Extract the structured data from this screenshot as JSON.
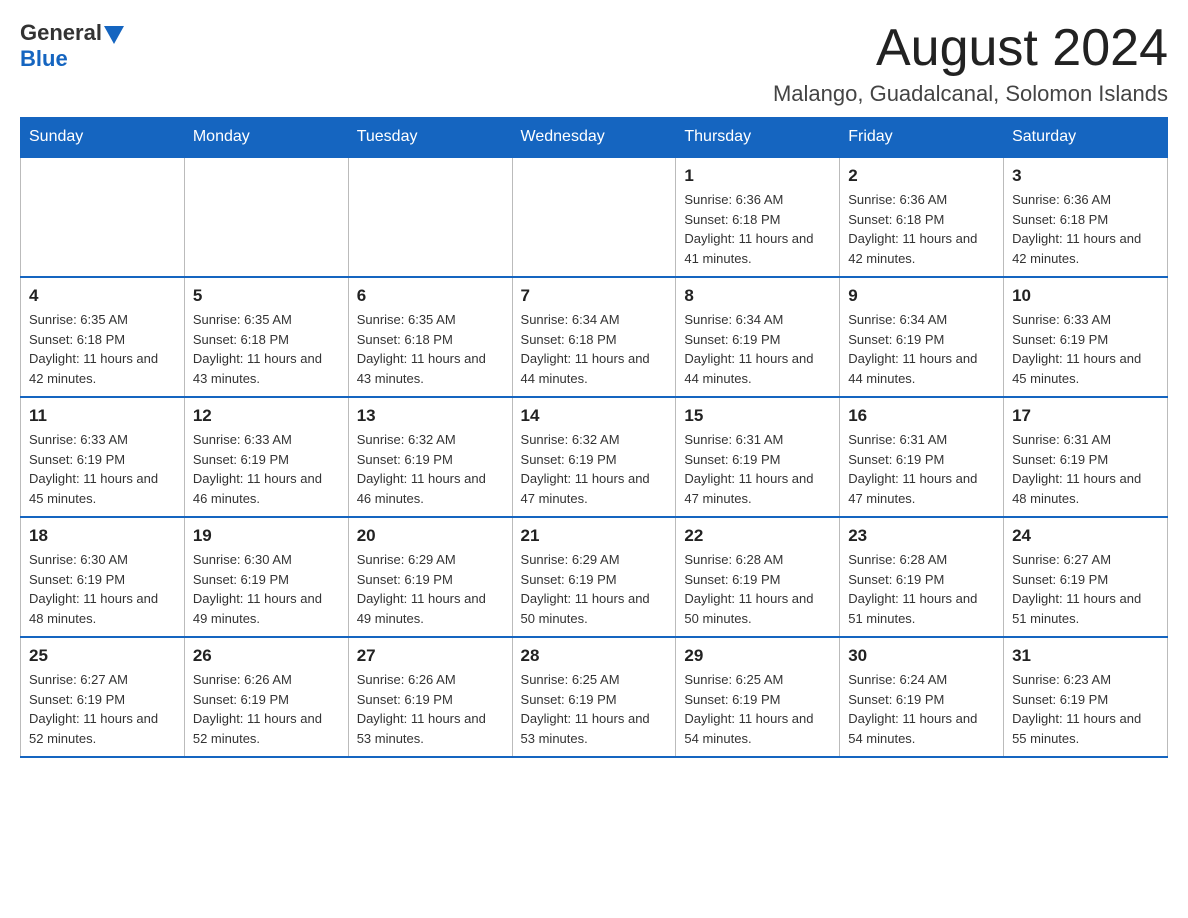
{
  "header": {
    "logo_general": "General",
    "logo_blue": "Blue",
    "month_year": "August 2024",
    "location": "Malango, Guadalcanal, Solomon Islands"
  },
  "days_of_week": [
    "Sunday",
    "Monday",
    "Tuesday",
    "Wednesday",
    "Thursday",
    "Friday",
    "Saturday"
  ],
  "weeks": [
    [
      {
        "day": "",
        "info": ""
      },
      {
        "day": "",
        "info": ""
      },
      {
        "day": "",
        "info": ""
      },
      {
        "day": "",
        "info": ""
      },
      {
        "day": "1",
        "info": "Sunrise: 6:36 AM\nSunset: 6:18 PM\nDaylight: 11 hours and 41 minutes."
      },
      {
        "day": "2",
        "info": "Sunrise: 6:36 AM\nSunset: 6:18 PM\nDaylight: 11 hours and 42 minutes."
      },
      {
        "day": "3",
        "info": "Sunrise: 6:36 AM\nSunset: 6:18 PM\nDaylight: 11 hours and 42 minutes."
      }
    ],
    [
      {
        "day": "4",
        "info": "Sunrise: 6:35 AM\nSunset: 6:18 PM\nDaylight: 11 hours and 42 minutes."
      },
      {
        "day": "5",
        "info": "Sunrise: 6:35 AM\nSunset: 6:18 PM\nDaylight: 11 hours and 43 minutes."
      },
      {
        "day": "6",
        "info": "Sunrise: 6:35 AM\nSunset: 6:18 PM\nDaylight: 11 hours and 43 minutes."
      },
      {
        "day": "7",
        "info": "Sunrise: 6:34 AM\nSunset: 6:18 PM\nDaylight: 11 hours and 44 minutes."
      },
      {
        "day": "8",
        "info": "Sunrise: 6:34 AM\nSunset: 6:19 PM\nDaylight: 11 hours and 44 minutes."
      },
      {
        "day": "9",
        "info": "Sunrise: 6:34 AM\nSunset: 6:19 PM\nDaylight: 11 hours and 44 minutes."
      },
      {
        "day": "10",
        "info": "Sunrise: 6:33 AM\nSunset: 6:19 PM\nDaylight: 11 hours and 45 minutes."
      }
    ],
    [
      {
        "day": "11",
        "info": "Sunrise: 6:33 AM\nSunset: 6:19 PM\nDaylight: 11 hours and 45 minutes."
      },
      {
        "day": "12",
        "info": "Sunrise: 6:33 AM\nSunset: 6:19 PM\nDaylight: 11 hours and 46 minutes."
      },
      {
        "day": "13",
        "info": "Sunrise: 6:32 AM\nSunset: 6:19 PM\nDaylight: 11 hours and 46 minutes."
      },
      {
        "day": "14",
        "info": "Sunrise: 6:32 AM\nSunset: 6:19 PM\nDaylight: 11 hours and 47 minutes."
      },
      {
        "day": "15",
        "info": "Sunrise: 6:31 AM\nSunset: 6:19 PM\nDaylight: 11 hours and 47 minutes."
      },
      {
        "day": "16",
        "info": "Sunrise: 6:31 AM\nSunset: 6:19 PM\nDaylight: 11 hours and 47 minutes."
      },
      {
        "day": "17",
        "info": "Sunrise: 6:31 AM\nSunset: 6:19 PM\nDaylight: 11 hours and 48 minutes."
      }
    ],
    [
      {
        "day": "18",
        "info": "Sunrise: 6:30 AM\nSunset: 6:19 PM\nDaylight: 11 hours and 48 minutes."
      },
      {
        "day": "19",
        "info": "Sunrise: 6:30 AM\nSunset: 6:19 PM\nDaylight: 11 hours and 49 minutes."
      },
      {
        "day": "20",
        "info": "Sunrise: 6:29 AM\nSunset: 6:19 PM\nDaylight: 11 hours and 49 minutes."
      },
      {
        "day": "21",
        "info": "Sunrise: 6:29 AM\nSunset: 6:19 PM\nDaylight: 11 hours and 50 minutes."
      },
      {
        "day": "22",
        "info": "Sunrise: 6:28 AM\nSunset: 6:19 PM\nDaylight: 11 hours and 50 minutes."
      },
      {
        "day": "23",
        "info": "Sunrise: 6:28 AM\nSunset: 6:19 PM\nDaylight: 11 hours and 51 minutes."
      },
      {
        "day": "24",
        "info": "Sunrise: 6:27 AM\nSunset: 6:19 PM\nDaylight: 11 hours and 51 minutes."
      }
    ],
    [
      {
        "day": "25",
        "info": "Sunrise: 6:27 AM\nSunset: 6:19 PM\nDaylight: 11 hours and 52 minutes."
      },
      {
        "day": "26",
        "info": "Sunrise: 6:26 AM\nSunset: 6:19 PM\nDaylight: 11 hours and 52 minutes."
      },
      {
        "day": "27",
        "info": "Sunrise: 6:26 AM\nSunset: 6:19 PM\nDaylight: 11 hours and 53 minutes."
      },
      {
        "day": "28",
        "info": "Sunrise: 6:25 AM\nSunset: 6:19 PM\nDaylight: 11 hours and 53 minutes."
      },
      {
        "day": "29",
        "info": "Sunrise: 6:25 AM\nSunset: 6:19 PM\nDaylight: 11 hours and 54 minutes."
      },
      {
        "day": "30",
        "info": "Sunrise: 6:24 AM\nSunset: 6:19 PM\nDaylight: 11 hours and 54 minutes."
      },
      {
        "day": "31",
        "info": "Sunrise: 6:23 AM\nSunset: 6:19 PM\nDaylight: 11 hours and 55 minutes."
      }
    ]
  ]
}
